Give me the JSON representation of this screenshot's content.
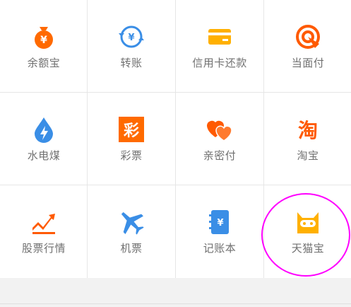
{
  "grid": {
    "rows": [
      [
        {
          "label": "余额宝",
          "icon": "money-bag-icon",
          "color": "#ff6a00"
        },
        {
          "label": "转账",
          "icon": "transfer-icon",
          "color": "#3a8ee6"
        },
        {
          "label": "信用卡还款",
          "icon": "credit-card-icon",
          "color": "#ffb000"
        },
        {
          "label": "当面付",
          "icon": "face-pay-icon",
          "color": "#ff5a00"
        }
      ],
      [
        {
          "label": "水电煤",
          "icon": "water-drop-icon",
          "color": "#3a8ee6"
        },
        {
          "label": "彩票",
          "icon": "lottery-icon",
          "color": "#ff6a00",
          "glyph": "彩"
        },
        {
          "label": "亲密付",
          "icon": "hearts-icon",
          "color": "#ff5a00"
        },
        {
          "label": "淘宝",
          "icon": "taobao-icon",
          "color": "#ff5a00",
          "glyph": "淘"
        }
      ],
      [
        {
          "label": "股票行情",
          "icon": "stock-chart-icon",
          "color": "#ff5a00"
        },
        {
          "label": "机票",
          "icon": "airplane-icon",
          "color": "#3a8ee6"
        },
        {
          "label": "记账本",
          "icon": "account-book-icon",
          "color": "#3a8ee6"
        },
        {
          "label": "天猫宝",
          "icon": "tmall-bag-icon",
          "color": "#ffb000"
        }
      ]
    ]
  },
  "annotation": {
    "color": "#ff00ff"
  }
}
